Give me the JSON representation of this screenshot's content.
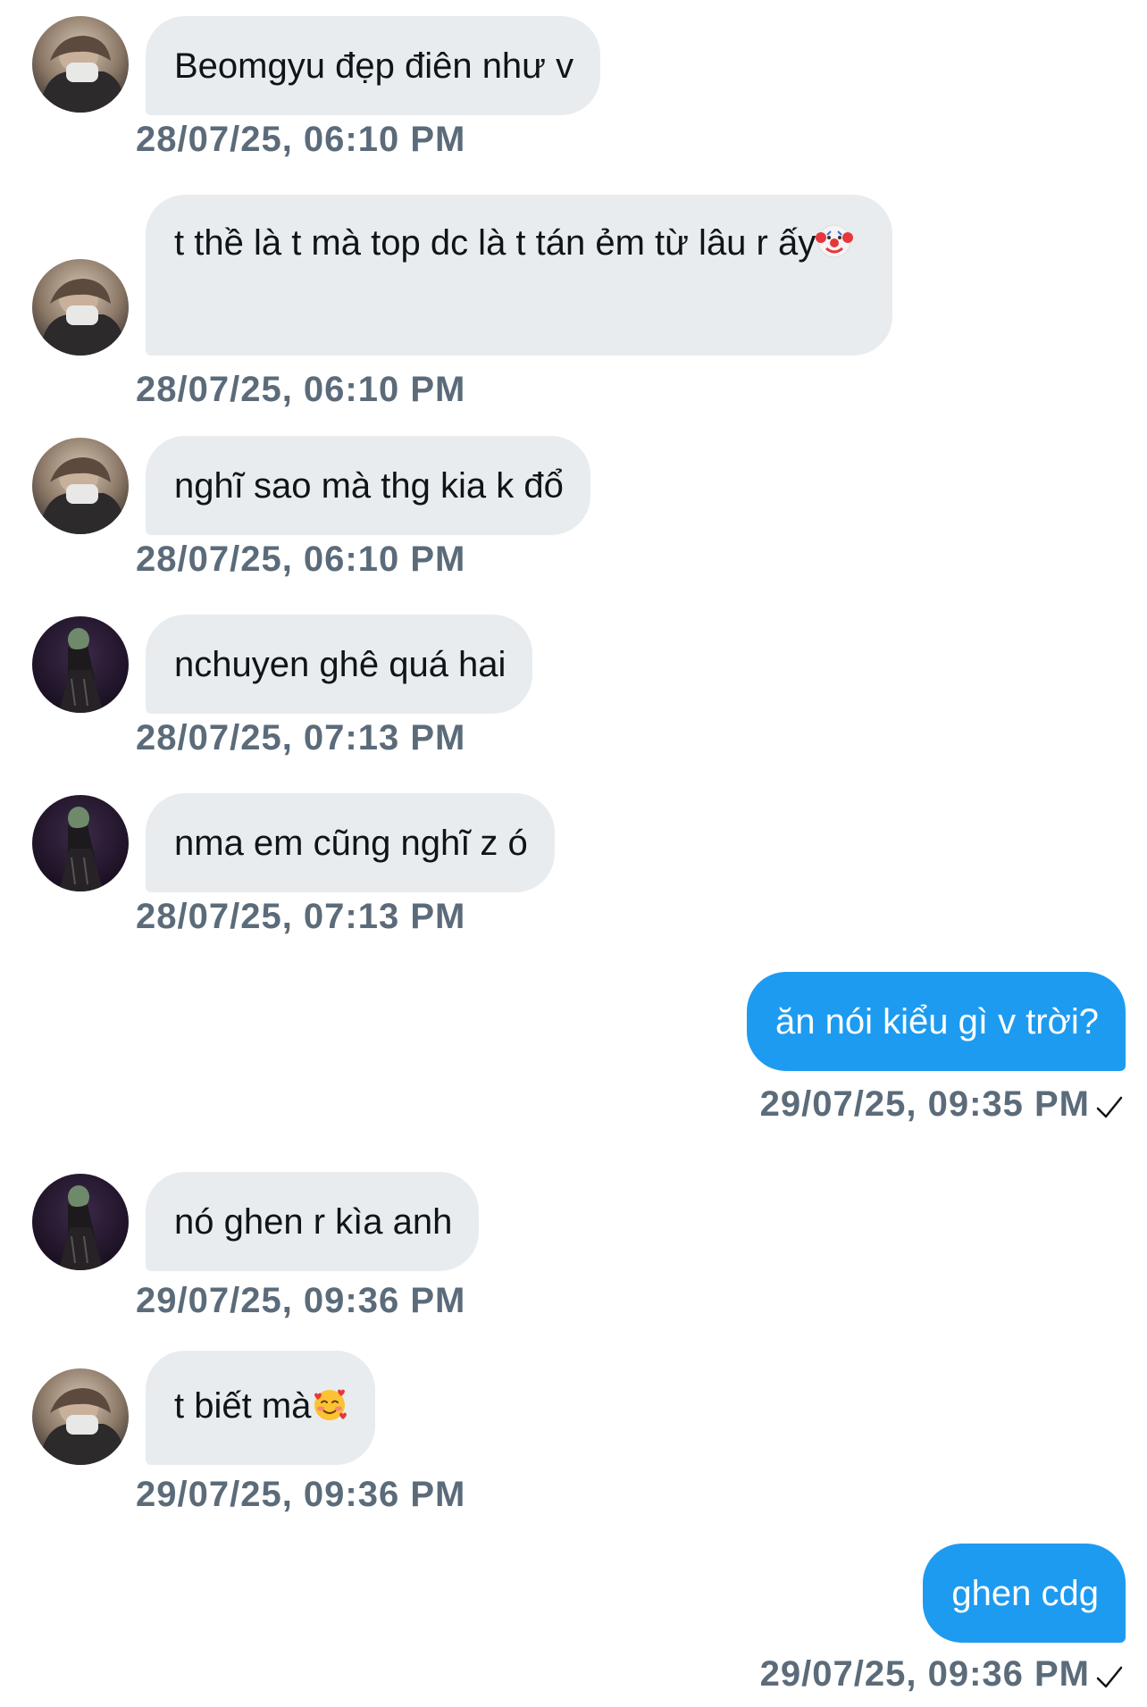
{
  "messages": [
    {
      "side": "in",
      "sender": "user-a",
      "text": "Beomgyu đẹp điên như v",
      "time": "28/07/25, 06:10 PM"
    },
    {
      "side": "in",
      "sender": "user-a",
      "text": "t thề là t mà top dc là t tán ẻm từ lâu r ấy",
      "emoji": "clown-face",
      "time": "28/07/25, 06:10 PM"
    },
    {
      "side": "in",
      "sender": "user-a",
      "text": "nghĩ sao mà thg kia k đổ",
      "time": "28/07/25, 06:10 PM"
    },
    {
      "side": "in",
      "sender": "user-b",
      "text": "nchuyen ghê quá hai",
      "time": "28/07/25, 07:13 PM"
    },
    {
      "side": "in",
      "sender": "user-b",
      "text": "nma em cũng nghĩ z ó",
      "time": "28/07/25, 07:13 PM"
    },
    {
      "side": "out",
      "text": "ăn nói kiểu gì v trời?",
      "time": "29/07/25, 09:35 PM",
      "status": "sent-check"
    },
    {
      "side": "in",
      "sender": "user-b",
      "text": "nó ghen r kìa anh",
      "time": "29/07/25, 09:36 PM"
    },
    {
      "side": "in",
      "sender": "user-a",
      "text": "t biết mà",
      "emoji": "smiling-face-with-hearts",
      "time": "29/07/25, 09:36 PM"
    },
    {
      "side": "out",
      "text": "ghen cdg",
      "time": "29/07/25, 09:36 PM",
      "status": "sent-check"
    }
  ],
  "colors": {
    "incoming_bubble": "#e9ecef",
    "outgoing_bubble": "#1d9bf0",
    "timestamp": "#5b6b7a"
  }
}
